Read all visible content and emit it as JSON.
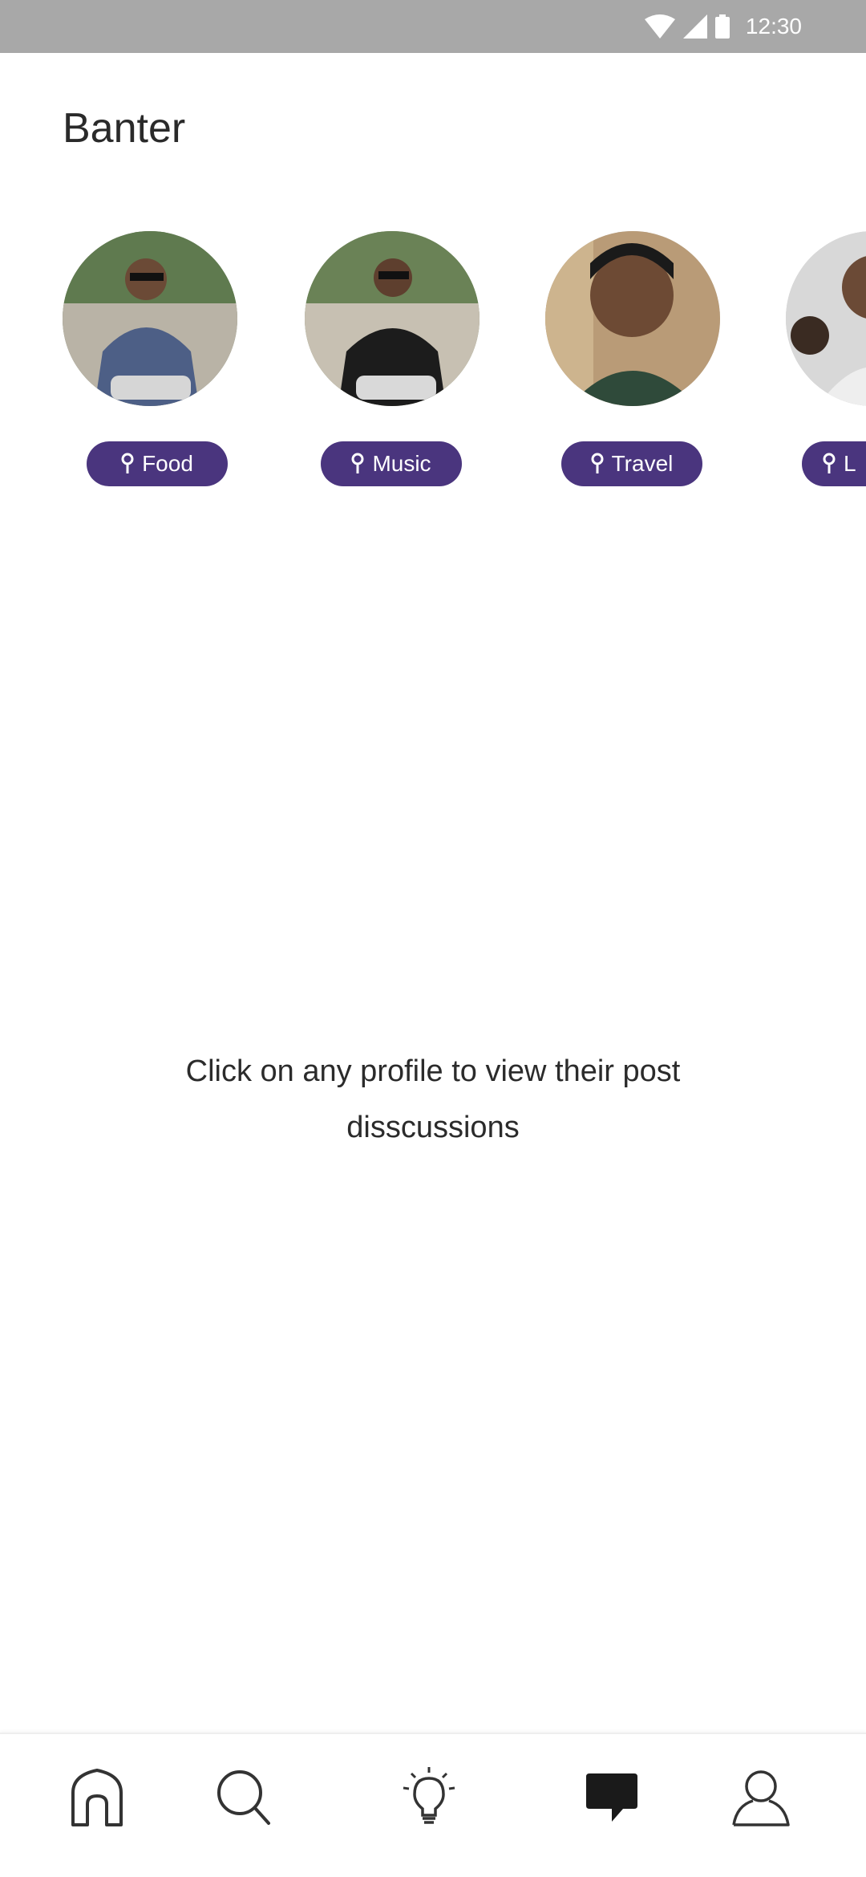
{
  "status_bar": {
    "time": "12:30"
  },
  "header": {
    "title": "Banter"
  },
  "profiles": [
    {
      "tag": "Food"
    },
    {
      "tag": "Music"
    },
    {
      "tag": "Travel"
    },
    {
      "tag": "L"
    }
  ],
  "hint": {
    "text": "Click on any profile to view their post disscussions"
  },
  "bottom_nav": {
    "items": [
      {
        "icon": "home-icon"
      },
      {
        "icon": "search-icon"
      },
      {
        "icon": "lightbulb-icon"
      },
      {
        "icon": "chat-bubble-icon",
        "active": true
      },
      {
        "icon": "profile-icon"
      }
    ]
  },
  "colors": {
    "accent": "#4a357e",
    "status_bar": "#a8a8a8"
  }
}
